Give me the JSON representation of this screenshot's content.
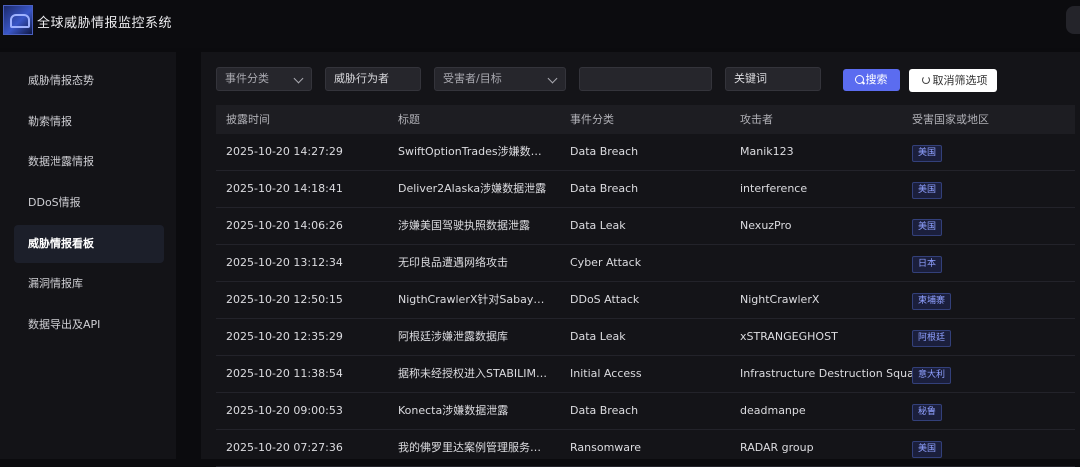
{
  "app": {
    "title": "全球威胁情报监控系统"
  },
  "sidebar": {
    "items": [
      {
        "label": "威胁情报态势",
        "active": false
      },
      {
        "label": "勒索情报",
        "active": false
      },
      {
        "label": "数据泄露情报",
        "active": false
      },
      {
        "label": "DDoS情报",
        "active": false
      },
      {
        "label": "威胁情报看板",
        "active": true
      },
      {
        "label": "漏洞情报库",
        "active": false
      },
      {
        "label": "数据导出及API",
        "active": false
      }
    ]
  },
  "filters": {
    "category_placeholder": "事件分类",
    "actor_value": "威胁行为者",
    "victim_placeholder": "受害者/目标",
    "blank_value": "",
    "keyword_value": "关键词",
    "search_label": "搜索",
    "clear_label": "取消筛选项"
  },
  "table": {
    "headers": [
      "披露时间",
      "标题",
      "事件分类",
      "攻击者",
      "受害国家或地区"
    ],
    "rows": [
      {
        "time": "2025-10-20 14:27:29",
        "title": "SwiftOptionTrades涉嫌数据泄露",
        "category": "Data Breach",
        "attacker": "Manik123",
        "country": "美国"
      },
      {
        "time": "2025-10-20 14:18:41",
        "title": "Deliver2Alaska涉嫌数据泄露",
        "category": "Data Breach",
        "attacker": "interference",
        "country": "美国"
      },
      {
        "time": "2025-10-20 14:06:26",
        "title": "涉嫌美国驾驶执照数据泄露",
        "category": "Data Leak",
        "attacker": "NexuzPro",
        "country": "美国"
      },
      {
        "time": "2025-10-20 13:12:34",
        "title": "无印良品遭遇网络攻击",
        "category": "Cyber Attack",
        "attacker": "",
        "country": "日本"
      },
      {
        "time": "2025-10-20 12:50:15",
        "title": "NigthCrawlerX针对SabayFlix的…",
        "category": "DDoS Attack",
        "attacker": "NightCrawlerX",
        "country": "柬埔寨"
      },
      {
        "time": "2025-10-20 12:35:29",
        "title": "阿根廷涉嫌泄露数据库",
        "category": "Data Leak",
        "attacker": "xSTRANGEGHOST",
        "country": "阿根廷"
      },
      {
        "time": "2025-10-20 11:38:54",
        "title": "据称未经授权进入STABILIMEN…",
        "category": "Initial Access",
        "attacker": "Infrastructure Destruction Squad",
        "country": "意大利"
      },
      {
        "time": "2025-10-20 09:00:53",
        "title": "Konecta涉嫌数据泄露",
        "category": "Data Breach",
        "attacker": "deadmanpe",
        "country": "秘鲁"
      },
      {
        "time": "2025-10-20 07:27:36",
        "title": "我的佛罗里达案例管理服务有限…",
        "category": "Ransomware",
        "attacker": "RADAR group",
        "country": "美国"
      }
    ]
  },
  "colors": {
    "accent": "#5b6cf0",
    "badge_text": "#8fa0ff",
    "sidebar_bg": "#131317",
    "main_bg": "#141418"
  }
}
